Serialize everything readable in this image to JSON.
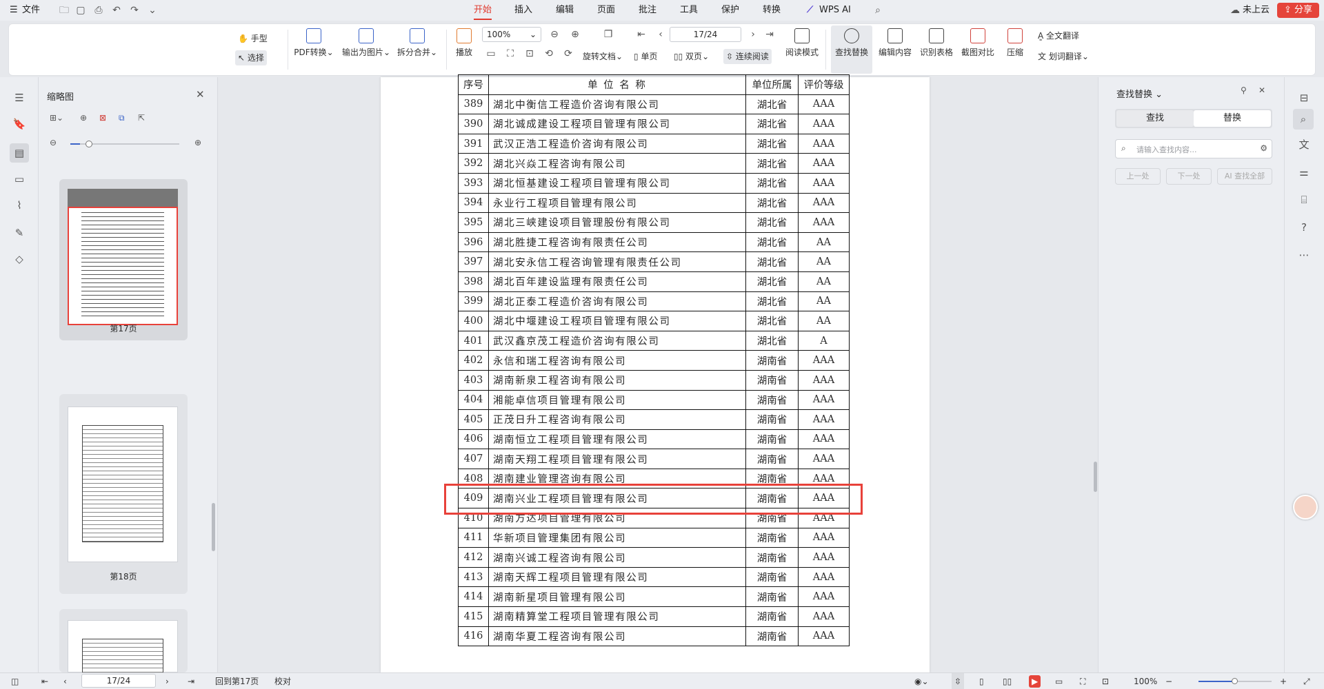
{
  "menubar": {
    "file_label": "文件",
    "tabs": [
      "开始",
      "插入",
      "编辑",
      "页面",
      "批注",
      "工具",
      "保护",
      "转换"
    ],
    "active_tab": "开始",
    "wps_ai_label": "WPS AI",
    "cloud_label": "未上云",
    "share_label": "分享"
  },
  "ribbon": {
    "hand_label": "手型",
    "select_label": "选择",
    "pdf_convert_label": "PDF转换",
    "export_image_label": "输出为图片",
    "split_merge_label": "拆分合并",
    "play_label": "播放",
    "zoom_value": "100%",
    "page_value": "17/24",
    "rotate_label": "旋转文档",
    "single_label": "单页",
    "double_label": "双页",
    "continuous_label": "连续阅读",
    "read_mode_label": "阅读模式",
    "find_replace_label": "查找替换",
    "edit_content_label": "编辑内容",
    "recognize_table_label": "识别表格",
    "screenshot_compare_label": "截图对比",
    "compress_label": "压缩",
    "full_translate_label": "全文翻译",
    "word_translate_label": "划词翻译"
  },
  "thumbnails": {
    "title": "缩略图",
    "pages": [
      {
        "label": "第17页"
      },
      {
        "label": "第18页"
      }
    ]
  },
  "table": {
    "headers": [
      "序号",
      "单 位 名 称",
      "单位所属",
      "评价等级"
    ],
    "rows": [
      [
        "389",
        "湖北中衡信工程造价咨询有限公司",
        "湖北省",
        "AAA"
      ],
      [
        "390",
        "湖北诚成建设工程项目管理有限公司",
        "湖北省",
        "AAA"
      ],
      [
        "391",
        "武汉正浩工程造价咨询有限公司",
        "湖北省",
        "AAA"
      ],
      [
        "392",
        "湖北兴焱工程咨询有限公司",
        "湖北省",
        "AAA"
      ],
      [
        "393",
        "湖北恒基建设工程项目管理有限公司",
        "湖北省",
        "AAA"
      ],
      [
        "394",
        "永业行工程项目管理有限公司",
        "湖北省",
        "AAA"
      ],
      [
        "395",
        "湖北三峡建设项目管理股份有限公司",
        "湖北省",
        "AAA"
      ],
      [
        "396",
        "湖北胜捷工程咨询有限责任公司",
        "湖北省",
        "AA"
      ],
      [
        "397",
        "湖北安永信工程咨询管理有限责任公司",
        "湖北省",
        "AA"
      ],
      [
        "398",
        "湖北百年建设监理有限责任公司",
        "湖北省",
        "AA"
      ],
      [
        "399",
        "湖北正泰工程造价咨询有限公司",
        "湖北省",
        "AA"
      ],
      [
        "400",
        "湖北中堰建设工程项目管理有限公司",
        "湖北省",
        "AA"
      ],
      [
        "401",
        "武汉鑫京茂工程造价咨询有限公司",
        "湖北省",
        "A"
      ],
      [
        "402",
        "永信和瑞工程咨询有限公司",
        "湖南省",
        "AAA"
      ],
      [
        "403",
        "湖南新泉工程咨询有限公司",
        "湖南省",
        "AAA"
      ],
      [
        "404",
        "湘能卓信项目管理有限公司",
        "湖南省",
        "AAA"
      ],
      [
        "405",
        "正茂日升工程咨询有限公司",
        "湖南省",
        "AAA"
      ],
      [
        "406",
        "湖南恒立工程项目管理有限公司",
        "湖南省",
        "AAA"
      ],
      [
        "407",
        "湖南天翔工程项目管理有限公司",
        "湖南省",
        "AAA"
      ],
      [
        "408",
        "湖南建业管理咨询有限公司",
        "湖南省",
        "AAA"
      ],
      [
        "409",
        "湖南兴业工程项目管理有限公司",
        "湖南省",
        "AAA"
      ],
      [
        "410",
        "湖南方达项目管理有限公司",
        "湖南省",
        "AAA"
      ],
      [
        "411",
        "华新项目管理集团有限公司",
        "湖南省",
        "AAA"
      ],
      [
        "412",
        "湖南兴诚工程咨询有限公司",
        "湖南省",
        "AAA"
      ],
      [
        "413",
        "湖南天辉工程项目管理有限公司",
        "湖南省",
        "AAA"
      ],
      [
        "414",
        "湖南新星项目管理有限公司",
        "湖南省",
        "AAA"
      ],
      [
        "415",
        "湖南精算堂工程项目管理有限公司",
        "湖南省",
        "AAA"
      ],
      [
        "416",
        "湖南华夏工程咨询有限公司",
        "湖南省",
        "AAA"
      ]
    ],
    "highlighted_row": "409"
  },
  "find_panel": {
    "title": "查找替换",
    "tab_find": "查找",
    "tab_replace": "替换",
    "search_placeholder": "请输入查找内容...",
    "prev_label": "上一处",
    "next_label": "下一处",
    "ai_find_all_label": "AI 查找全部"
  },
  "statusbar": {
    "page_value": "17/24",
    "back_label": "回到第17页",
    "proofread_label": "校对",
    "zoom_label": "100%"
  },
  "colors": {
    "accent": "#e03a2f",
    "highlight_box": "#e8413a"
  }
}
